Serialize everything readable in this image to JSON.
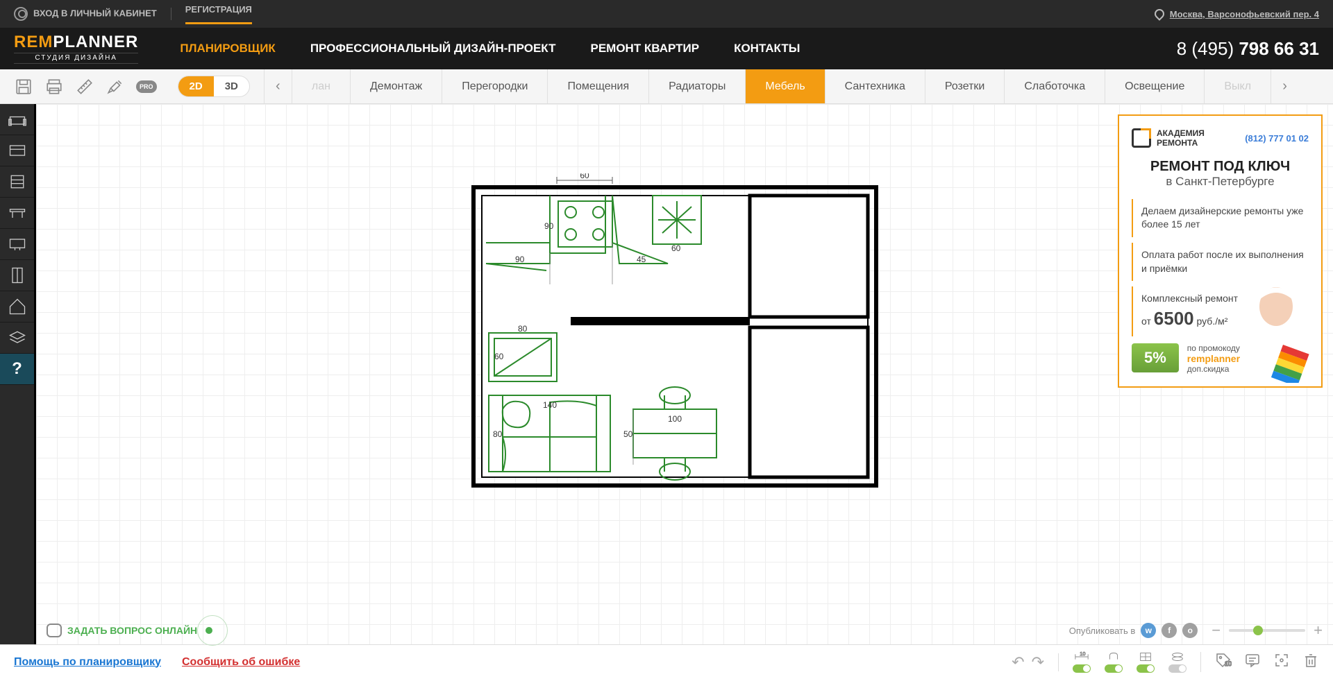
{
  "topbar": {
    "login": "ВХОД В ЛИЧНЫЙ КАБИНЕТ",
    "register": "РЕГИСТРАЦИЯ",
    "location": "Москва, Варсонофьевский пер. 4"
  },
  "logo": {
    "rem": "REM",
    "planner": "PLANNER",
    "sub": "СТУДИЯ ДИЗАЙНА"
  },
  "nav": {
    "items": [
      "ПЛАНИРОВЩИК",
      "ПРОФЕССИОНАЛЬНЫЙ ДИЗАЙН-ПРОЕКТ",
      "РЕМОНТ КВАРТИР",
      "КОНТАКТЫ"
    ],
    "phone_prefix": "8 (495) ",
    "phone": "798 66 31"
  },
  "toolbar": {
    "view2d": "2D",
    "view3d": "3D",
    "pro": "PRO",
    "tabs": [
      "лан",
      "Демонтаж",
      "Перегородки",
      "Помещения",
      "Радиаторы",
      "Мебель",
      "Сантехника",
      "Розетки",
      "Слаботочка",
      "Освещение",
      "Выкл"
    ]
  },
  "floorplan": {
    "dims": {
      "top": "60",
      "k1": "90",
      "k2": "90",
      "k3": "45",
      "k4": "60",
      "tv_w": "80",
      "tv_h": "60",
      "sofa_w": "140",
      "sofa_h": "80",
      "table_w": "100",
      "table_h": "50"
    }
  },
  "ad": {
    "brand1": "АКАДЕМИЯ",
    "brand2": "РЕМОНТА",
    "phone": "(812) 777 01 02",
    "title": "РЕМОНТ ПОД КЛЮЧ",
    "subtitle": "в Санкт-Петербурге",
    "f1": "Делаем дизайнерские ремонты уже более 15 лет",
    "f2": "Оплата работ после их выполнения и приёмки",
    "f3_pre": "Комплексный ремонт",
    "f3_from": "от ",
    "f3_price": "6500",
    "f3_unit": " руб./м²",
    "badge": "5%",
    "promo_label": "по промокоду",
    "promo_code": "remplanner",
    "promo_extra": "доп.скидка"
  },
  "canvas_footer": {
    "ask": "ЗАДАТЬ ВОПРОС ОНЛАЙН",
    "publish": "Опубликовать в"
  },
  "bottombar": {
    "help": "Помощь по планировщику",
    "error": "Сообщить об ошибке"
  }
}
